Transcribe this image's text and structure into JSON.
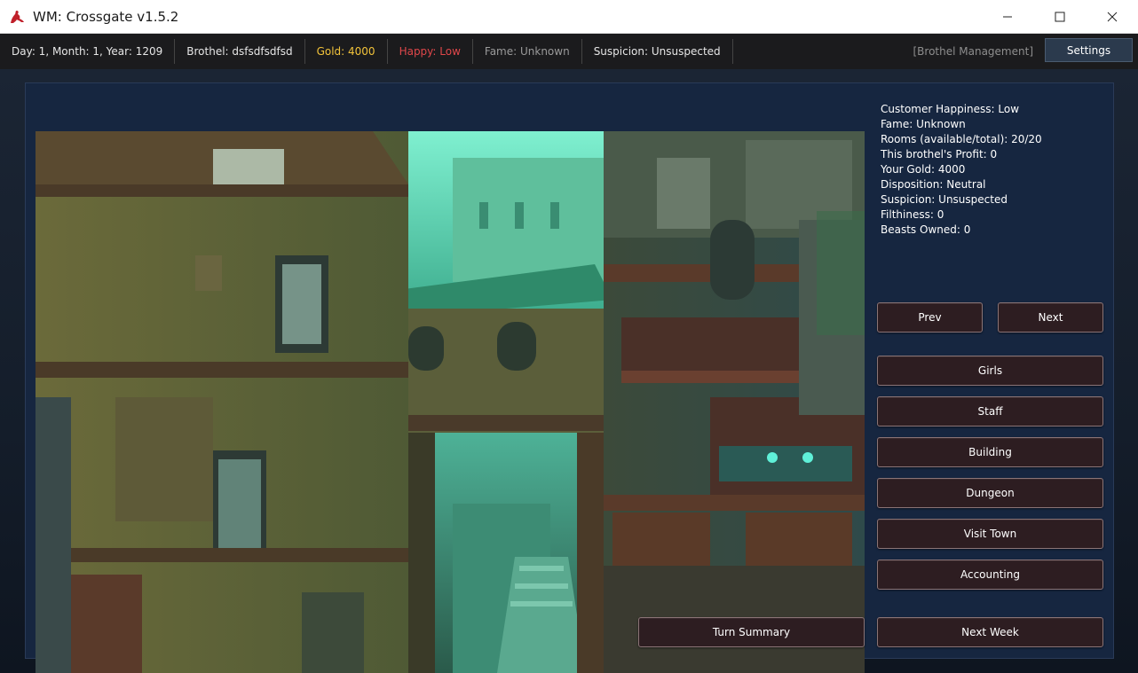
{
  "window": {
    "title": "WM: Crossgate v1.5.2",
    "app_icon": "red-figure-icon",
    "controls": [
      "minimize-icon",
      "maximize-icon",
      "close-icon"
    ]
  },
  "status": {
    "date": "Day: 1, Month: 1, Year: 1209",
    "brothel": "Brothel: dsfsdfsdfsd",
    "gold": "Gold: 4000",
    "happy": "Happy: Low",
    "fame": "Fame: Unknown",
    "suspicion": "Suspicion: Unsuspected",
    "mode": "[Brothel Management]",
    "settings_label": "Settings"
  },
  "colors": {
    "gold": "#f2c33a",
    "happy": "#e0474a",
    "fame": "#9a9a9a",
    "panel": "#162640",
    "button": "#2d1d21"
  },
  "info": {
    "lines": [
      "Customer Happiness: Low",
      "Fame: Unknown",
      "Rooms (available/total): 20/20",
      "This brothel's Profit: 0",
      "Your Gold: 4000",
      "Disposition: Neutral",
      "Suspicion: Unsuspected",
      "Filthiness: 0",
      "Beasts Owned: 0"
    ]
  },
  "nav": {
    "prev": "Prev",
    "next": "Next"
  },
  "menu": {
    "girls": "Girls",
    "staff": "Staff",
    "building": "Building",
    "dungeon": "Dungeon",
    "visit_town": "Visit Town",
    "accounting": "Accounting"
  },
  "actions": {
    "turn_summary": "Turn Summary",
    "next_week": "Next Week"
  }
}
